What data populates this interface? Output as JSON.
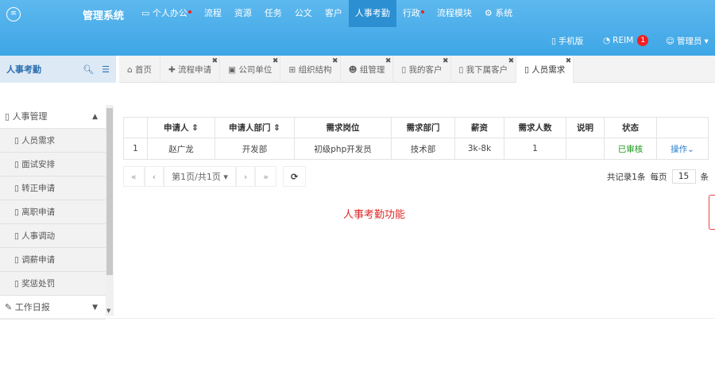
{
  "app": {
    "title": "管理系统",
    "logo_icon": "chat-icon"
  },
  "nav": [
    {
      "label": "个人办公",
      "icon": "monitor-icon",
      "dot": true
    },
    {
      "label": "流程"
    },
    {
      "label": "资源"
    },
    {
      "label": "任务"
    },
    {
      "label": "公文"
    },
    {
      "label": "客户"
    },
    {
      "label": "人事考勤",
      "active": true
    },
    {
      "label": "行政",
      "dot": true
    },
    {
      "label": "流程模块"
    },
    {
      "label": "系统",
      "icon": "gear-icon"
    }
  ],
  "subbar": {
    "mobile": "手机版",
    "reim": "REIM",
    "reim_count": "1",
    "user": "管理员"
  },
  "sidebar": {
    "title": "人事考勤",
    "group": "人事管理",
    "items": [
      "人员需求",
      "面试安排",
      "转正申请",
      "离职申请",
      "人事调动",
      "调薪申请",
      "奖惩处罚"
    ],
    "group2": "工作日报"
  },
  "tabs": [
    {
      "label": "首页",
      "icon": "home-icon"
    },
    {
      "label": "流程申请",
      "icon": "plus-icon",
      "closable": true
    },
    {
      "label": "公司单位",
      "icon": "building-icon",
      "closable": true
    },
    {
      "label": "组织结构",
      "icon": "sitemap-icon",
      "closable": true
    },
    {
      "label": "组管理",
      "icon": "users-icon",
      "closable": true
    },
    {
      "label": "我的客户",
      "icon": "bookmark-icon",
      "closable": true
    },
    {
      "label": "我下属客户",
      "icon": "bookmark-icon",
      "closable": true
    },
    {
      "label": "人员需求",
      "icon": "bookmark-icon",
      "closable": true,
      "active": true
    }
  ],
  "table": {
    "headers": [
      "",
      "申请人 ⇕",
      "申请人部门 ⇕",
      "需求岗位",
      "需求部门",
      "薪资",
      "需求人数",
      "说明",
      "状态",
      ""
    ],
    "rows": [
      [
        "1",
        "赵广龙",
        "开发部",
        "初级php开发员",
        "技术部",
        "3k-8k",
        "1",
        "",
        "已审核",
        "操作⌄"
      ]
    ]
  },
  "pager": {
    "first": "«",
    "prev": "‹",
    "page": "第1页/共1页 ▾",
    "next": "›",
    "last": "»",
    "refresh": "⟳",
    "total": "共记录1条",
    "per_label": "每页",
    "per_value": "15",
    "unit": "条"
  },
  "message": "人事考勤功能",
  "colors": {
    "header": "#3ea6e6",
    "active_nav": "#2b8fd1",
    "status_ok": "#1a9a1a",
    "message": "#e02a2a"
  }
}
